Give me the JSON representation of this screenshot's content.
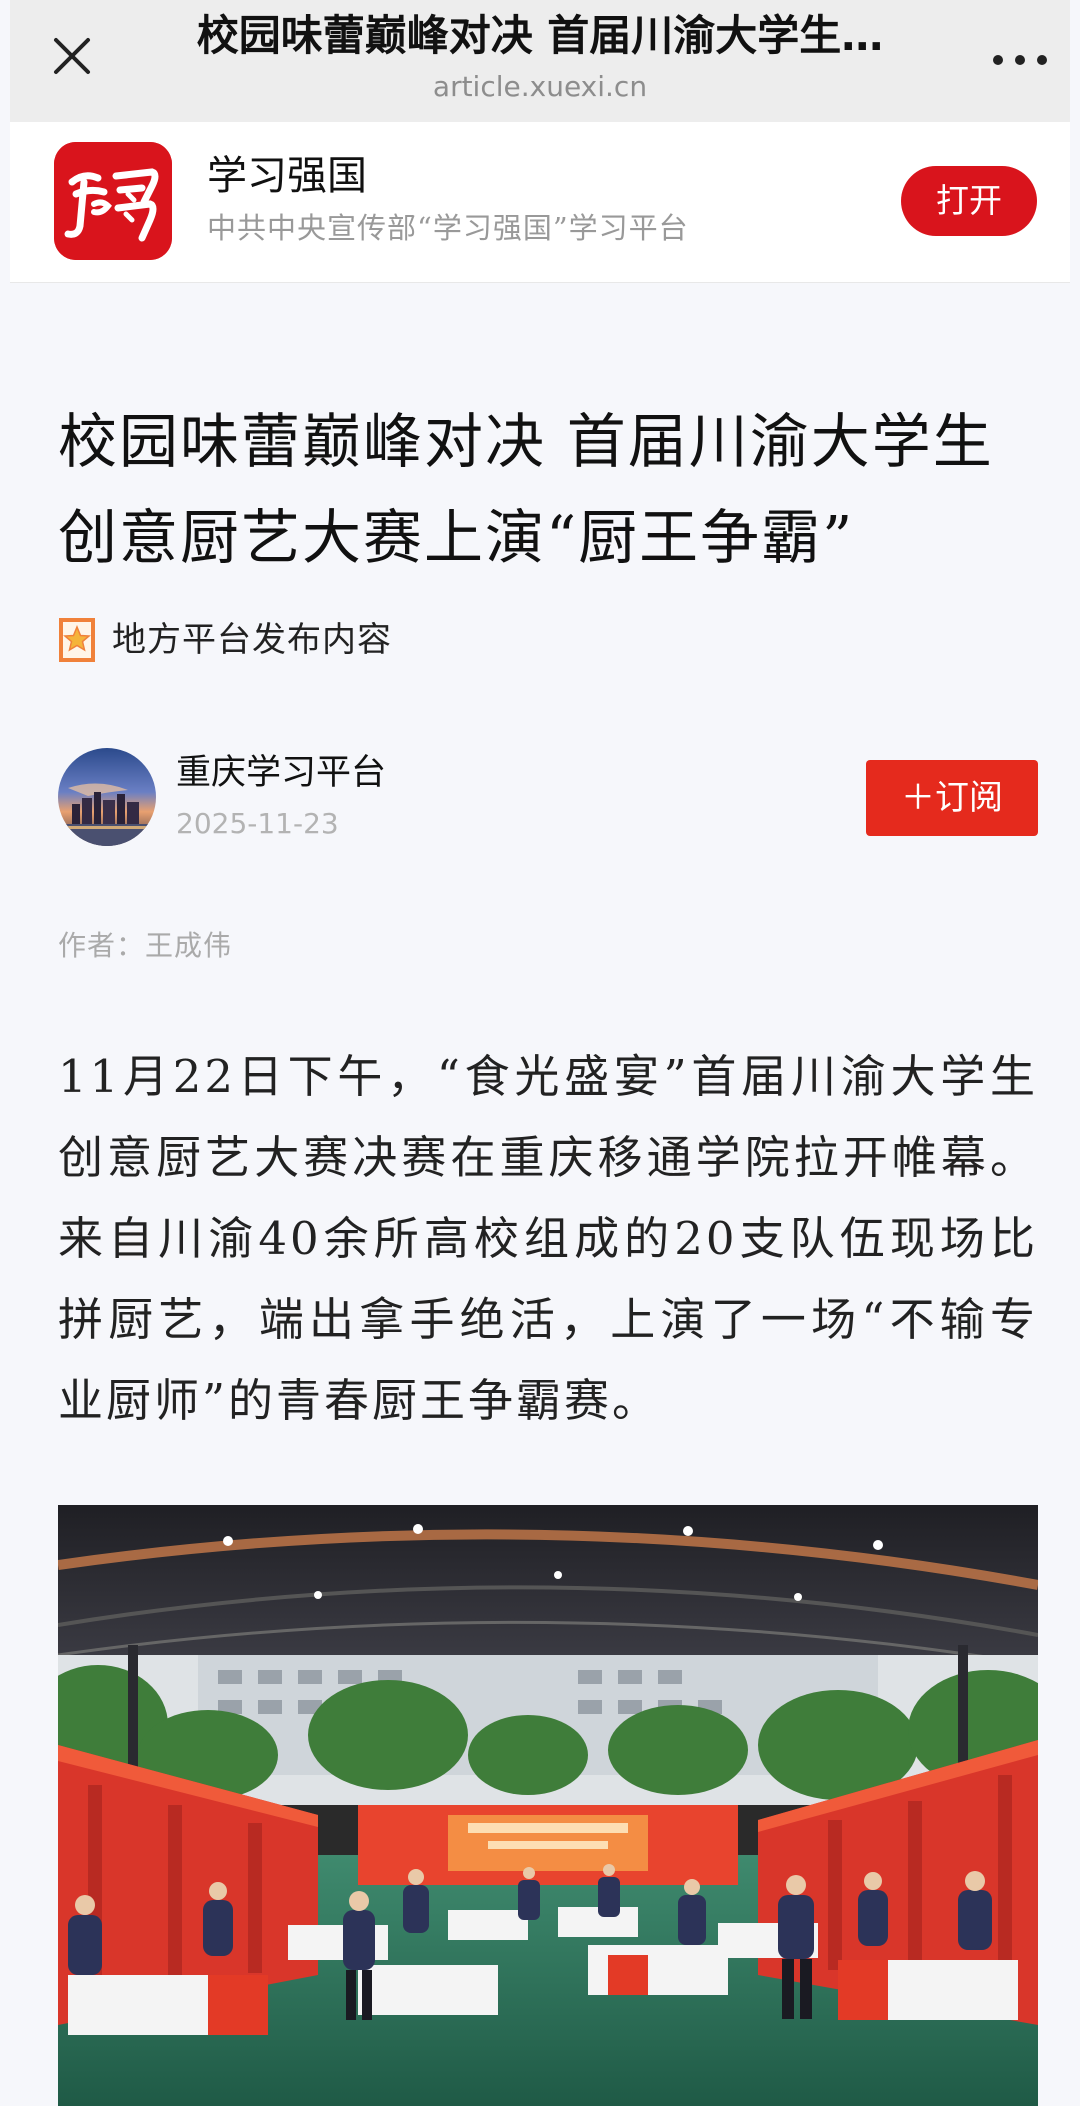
{
  "browser": {
    "title": "校园味蕾巅峰对决 首届川渝大学生…",
    "url": "article.xuexi.cn",
    "close_icon": "close-icon",
    "more_icon": "more-horizontal-icon"
  },
  "app_banner": {
    "logo_icon": "xuexi-logo",
    "name": "学习强国",
    "subtitle": "中共中央宣传部“学习强国”学习平台",
    "open_label": "打开",
    "brand_color": "#d9141c"
  },
  "article": {
    "title": "校园味蕾巅峰对决 首届川渝大学生创意厨艺大赛上演“厨王争霸”",
    "tag_icon": "star-badge-icon",
    "tag_label": "地方平台发布内容",
    "source": {
      "name": "重庆学习平台",
      "date": "2025-11-23",
      "avatar": "city-skyline-avatar",
      "subscribe_label": "＋订阅",
      "subscribe_color": "#e52a1d"
    },
    "byline": "作者：王成伟",
    "paragraph": "11月22日下午，“食光盛宴”首届川渝大学生创意厨艺大赛决赛在重庆移通学院拉开帷幕。来自川渝40余所高校组成的20支队伍现场比拼厨艺，端出拿手绝活，上演了一场“不输专业厨师”的青春厨王争霸赛。",
    "photo": "cooking-competition-venue-photo"
  }
}
